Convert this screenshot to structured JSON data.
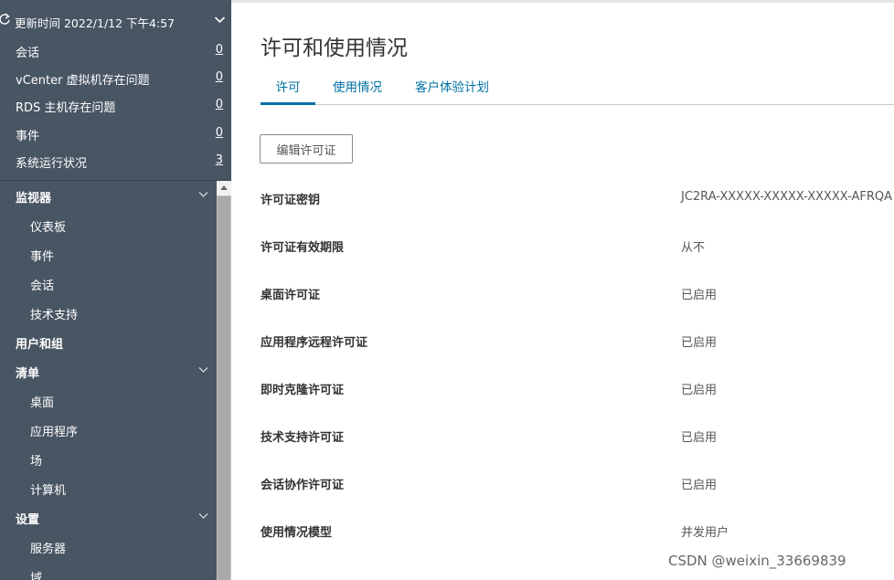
{
  "status": {
    "update_label": "更新时间 2022/1/12 下午4:57",
    "rows": [
      {
        "label": "会话",
        "count": "0"
      },
      {
        "label": "vCenter 虚拟机存在问题",
        "count": "0"
      },
      {
        "label": "RDS 主机存在问题",
        "count": "0"
      },
      {
        "label": "事件",
        "count": "0"
      },
      {
        "label": "系统运行状况",
        "count": "3"
      }
    ]
  },
  "nav": {
    "monitor": {
      "label": "监视器",
      "children": [
        "仪表板",
        "事件",
        "会话",
        "技术支持"
      ]
    },
    "users_groups": {
      "label": "用户和组"
    },
    "inventory": {
      "label": "清单",
      "children": [
        "桌面",
        "应用程序",
        "场",
        "计算机"
      ]
    },
    "settings": {
      "label": "设置",
      "children": [
        "服务器",
        "域"
      ]
    }
  },
  "main": {
    "title": "许可和使用情况",
    "tabs": [
      {
        "label": "许可",
        "active": true
      },
      {
        "label": "使用情况",
        "active": false
      },
      {
        "label": "客户体验计划",
        "active": false
      }
    ],
    "edit_button": "编辑许可证",
    "properties": [
      {
        "key": "许可证密钥",
        "value": "JC2RA-XXXXX-XXXXX-XXXXX-AFRQA"
      },
      {
        "key": "许可证有效期限",
        "value": "从不"
      },
      {
        "key": "桌面许可证",
        "value": "已启用"
      },
      {
        "key": "应用程序远程许可证",
        "value": "已启用"
      },
      {
        "key": "即时克隆许可证",
        "value": "已启用"
      },
      {
        "key": "技术支持许可证",
        "value": "已启用"
      },
      {
        "key": "会话协作许可证",
        "value": "已启用"
      },
      {
        "key": "使用情况模型",
        "value": "并发用户"
      }
    ]
  },
  "watermark": "CSDN @weixin_33669839",
  "colors": {
    "sidebar_bg": "#485563",
    "accent": "#0072a3",
    "text_dark": "#333333",
    "text_muted": "#565656"
  }
}
